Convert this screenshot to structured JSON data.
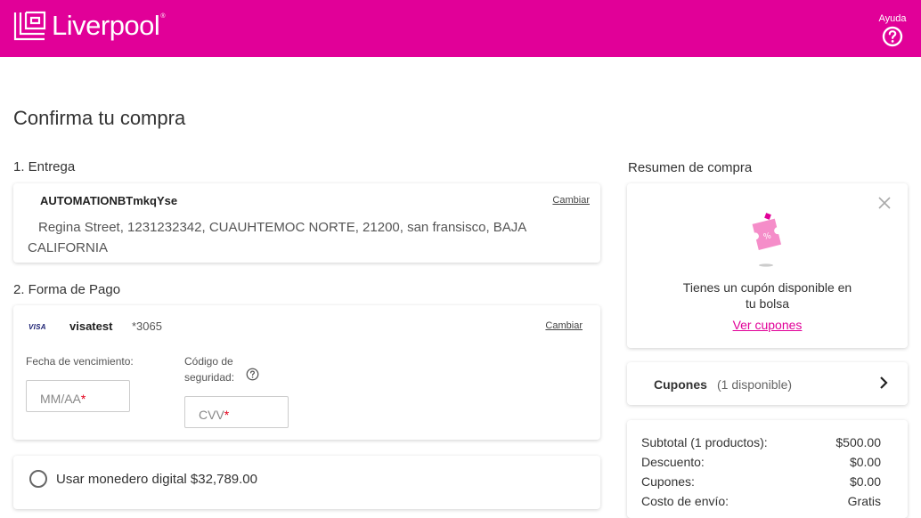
{
  "header": {
    "brand": "Liverpool",
    "help_label": "Ayuda",
    "brand_color": "#e10098"
  },
  "page_title": "Confirma tu compra",
  "delivery": {
    "section_label": "1. Entrega",
    "recipient": "AUTOMATIONBTmkqYse",
    "change_label": "Cambiar",
    "address": "Regina Street, 1231232342, CUAUHTEMOC NORTE, 21200, san fransisco, BAJA CALIFORNIA"
  },
  "payment": {
    "section_label": "2. Forma de Pago",
    "card_brand_icon": "VISA",
    "card_name": "visatest",
    "card_number": "*3065",
    "change_label": "Cambiar",
    "expiry_label": "Fecha de vencimiento:",
    "expiry_placeholder": "MM/AA",
    "security_label_line1": "Código de",
    "security_label_line2": "seguridad:",
    "cvv_placeholder": "CVV",
    "required_mark": "*"
  },
  "wallet": {
    "label": "Usar monedero digital $32,789.00"
  },
  "summary": {
    "title": "Resumen de compra",
    "coupon_card": {
      "text_line1": "Tienes un cupón disponible en",
      "text_line2": "tu bolsa",
      "link": "Ver cupones"
    },
    "coupons_row": {
      "title": "Cupones",
      "available": "(1 disponible)"
    },
    "rows": [
      {
        "label": "Subtotal (1 productos):",
        "value": "$500.00"
      },
      {
        "label": "Descuento:",
        "value": "$0.00"
      },
      {
        "label": "Cupones:",
        "value": "$0.00"
      },
      {
        "label": "Costo de envío:",
        "value": "Gratis"
      }
    ]
  }
}
